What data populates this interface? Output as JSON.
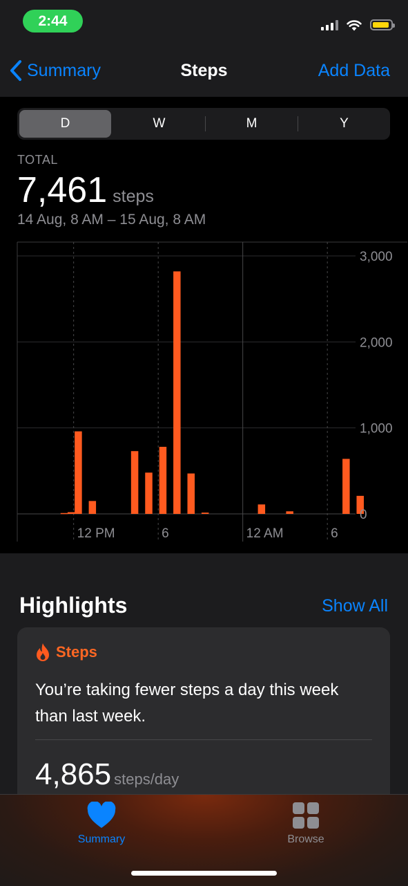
{
  "status_bar": {
    "time": "2:44"
  },
  "nav": {
    "back_label": "Summary",
    "title": "Steps",
    "action_label": "Add Data"
  },
  "segments": [
    {
      "label": "D",
      "active": true
    },
    {
      "label": "W",
      "active": false
    },
    {
      "label": "M",
      "active": false
    },
    {
      "label": "Y",
      "active": false
    }
  ],
  "summary": {
    "total_label": "TOTAL",
    "total_value": "7,461",
    "total_unit": "steps",
    "range": "14 Aug, 8 AM – 15 Aug, 8 AM"
  },
  "chart_data": {
    "type": "bar",
    "x_tick_labels": [
      "12 PM",
      "6",
      "12 AM",
      "6"
    ],
    "y_tick_labels": [
      "3,000",
      "2,000",
      "1,000",
      "0"
    ],
    "ylim": [
      0,
      3000
    ],
    "color": "#ff5a1f",
    "bars": [
      {
        "hour": 11,
        "value": 10
      },
      {
        "hour": 11.5,
        "value": 20
      },
      {
        "hour": 12,
        "value": 960
      },
      {
        "hour": 13,
        "value": 150
      },
      {
        "hour": 16,
        "value": 730
      },
      {
        "hour": 17,
        "value": 480
      },
      {
        "hour": 18,
        "value": 780
      },
      {
        "hour": 19,
        "value": 2820
      },
      {
        "hour": 20,
        "value": 470
      },
      {
        "hour": 21,
        "value": 15
      },
      {
        "hour": 25,
        "value": 110
      },
      {
        "hour": 27,
        "value": 30
      },
      {
        "hour": 31,
        "value": 640
      },
      {
        "hour": 32,
        "value": 210
      }
    ]
  },
  "highlights": {
    "title": "Highlights",
    "show_all": "Show All",
    "card": {
      "heading": "Steps",
      "text": "You’re taking fewer steps a day this week than last week.",
      "value": "4,865",
      "unit": "steps/day"
    }
  },
  "tabbar": {
    "tabs": [
      {
        "label": "Summary",
        "active": true,
        "icon": "heart-icon"
      },
      {
        "label": "Browse",
        "active": false,
        "icon": "grid-icon"
      }
    ],
    "active_color": "#0a84ff",
    "inactive_color": "#8e8e93"
  }
}
